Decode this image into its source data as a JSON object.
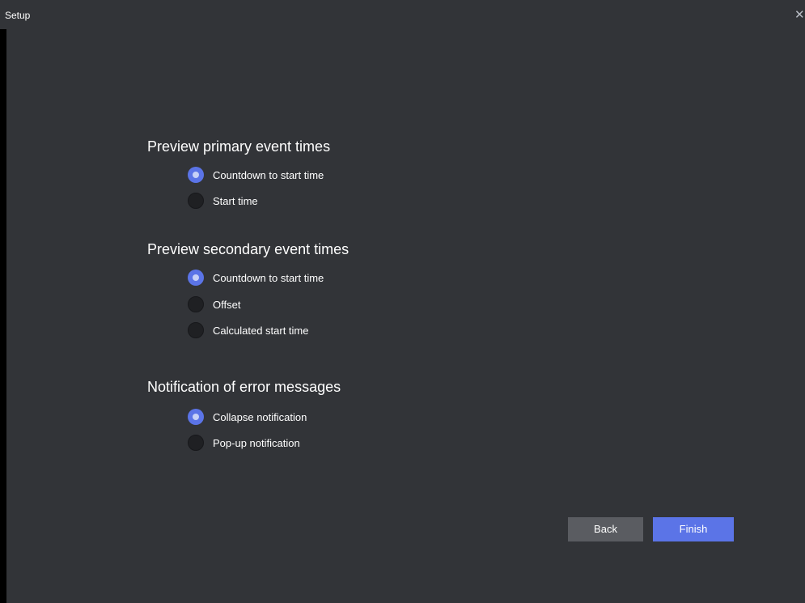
{
  "window": {
    "title": "Setup",
    "close_glyph": "✕"
  },
  "sections": [
    {
      "heading": "Preview primary event times",
      "options": [
        {
          "label": "Countdown to start time",
          "selected": true
        },
        {
          "label": "Start time",
          "selected": false
        }
      ]
    },
    {
      "heading": "Preview secondary event times",
      "options": [
        {
          "label": "Countdown to start time",
          "selected": true
        },
        {
          "label": "Offset",
          "selected": false
        },
        {
          "label": "Calculated start time",
          "selected": false
        }
      ]
    },
    {
      "heading": "Notification of error messages",
      "options": [
        {
          "label": "Collapse notification",
          "selected": true
        },
        {
          "label": "Pop-up notification",
          "selected": false
        }
      ]
    }
  ],
  "footer": {
    "back_label": "Back",
    "finish_label": "Finish"
  },
  "colors": {
    "background": "#323438",
    "accent": "#5b74e7",
    "secondary_button": "#5a5c61",
    "radio_off": "#1f2023"
  }
}
